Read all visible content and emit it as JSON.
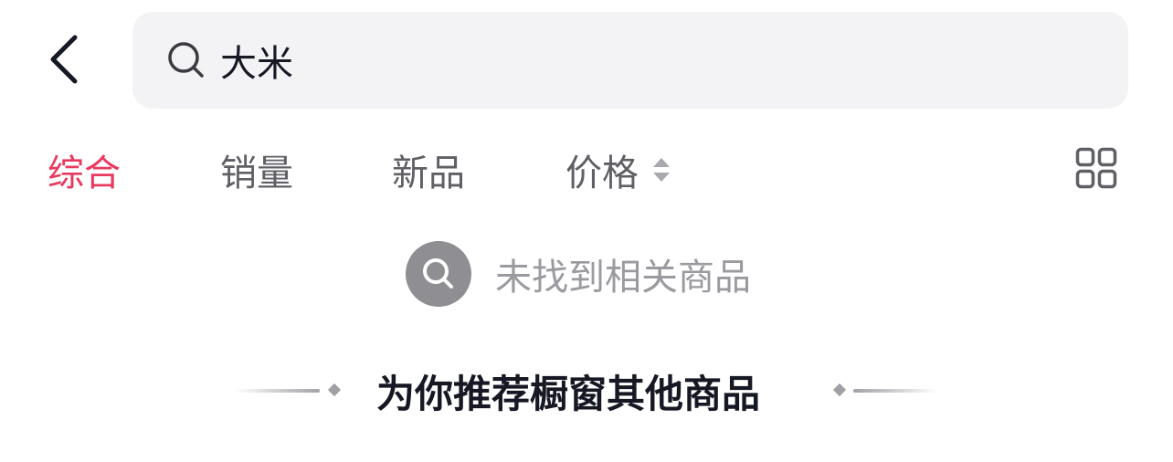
{
  "header": {
    "back_icon": "chevron-left-icon",
    "search": {
      "icon": "search-icon",
      "value": "大米"
    }
  },
  "tabs": [
    {
      "label": "综合",
      "active": true
    },
    {
      "label": "销量",
      "active": false
    },
    {
      "label": "新品",
      "active": false
    },
    {
      "label": "价格",
      "active": false,
      "sort_icon": "sort-up-down-icon"
    }
  ],
  "layout_toggle_icon": "grid-view-icon",
  "empty_state": {
    "icon": "search-circle-icon",
    "text": "未找到相关商品"
  },
  "recommend": {
    "title": "为你推荐橱窗其他商品"
  },
  "colors": {
    "accent": "#e83a5f",
    "tab_text": "#5f5f66",
    "muted_text": "#9a9aa0",
    "search_bg": "#f3f3f6",
    "primary_text": "#161823"
  }
}
